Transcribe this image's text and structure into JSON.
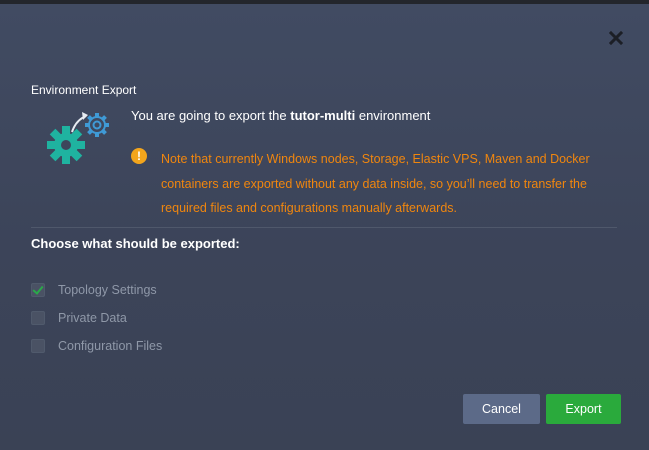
{
  "dialog": {
    "title": "Environment Export",
    "headline_prefix": "You are going to export the ",
    "environment_name": "tutor-multi",
    "headline_suffix": " environment",
    "warning": "Note that currently Windows nodes, Storage, Elastic VPS, Maven and Docker containers are exported without any data inside, so you’ll need to transfer the required files and configurations manually afterwards.",
    "warning_icon": "!",
    "choose_label": "Choose what should be exported:",
    "options": [
      {
        "label": "Topology Settings",
        "checked": true
      },
      {
        "label": "Private Data",
        "checked": false
      },
      {
        "label": "Configuration Files",
        "checked": false
      }
    ],
    "cancel_label": "Cancel",
    "export_label": "Export",
    "close_icon": "close-icon",
    "export_icon": "gears-export-icon"
  },
  "colors": {
    "warning_text": "#f0860e",
    "export_button": "#2aaa3c",
    "cancel_button": "#5c6a88",
    "gear_primary": "#1fb3a0",
    "gear_secondary": "#3f9ad6"
  }
}
